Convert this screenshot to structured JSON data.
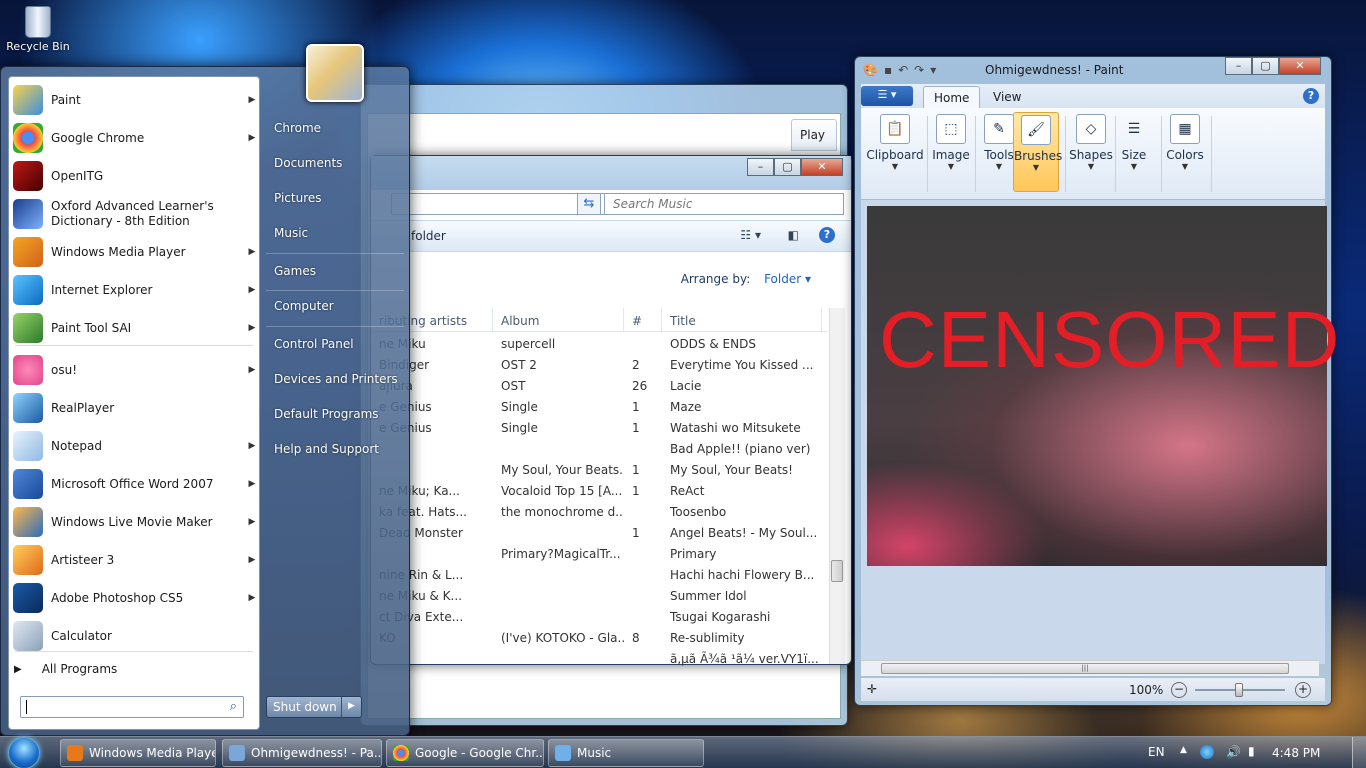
{
  "desktop": {
    "recycle_bin": "Recycle Bin"
  },
  "music_window": {
    "play_tab": "Play",
    "search_placeholder": "Search Music",
    "folder_crumb": "folder",
    "arrange_label": "Arrange by:",
    "arrange_value": "Folder",
    "columns": [
      "ributing artists",
      "Album",
      "#",
      "Title"
    ],
    "rows": [
      [
        "ne Miku",
        "supercell",
        "",
        "ODDS & ENDS"
      ],
      [
        "Bindiger",
        "OST 2",
        "2",
        "Everytime You Kissed ..."
      ],
      [
        "ajiura",
        "OST",
        "26",
        "Lacie"
      ],
      [
        "e Genius",
        "Single",
        "1",
        "Maze"
      ],
      [
        "e Genius",
        "Single",
        "1",
        "Watashi wo Mitsukete"
      ],
      [
        "",
        "",
        "",
        "Bad Apple!! (piano ver)"
      ],
      [
        "",
        "My Soul, Your Beats...",
        "1",
        "My Soul, Your Beats!"
      ],
      [
        "ne Miku; Ka...",
        "Vocaloid Top 15 [A...",
        "1",
        "ReAct"
      ],
      [
        "ka feat. Hats...",
        "the monochrome d...",
        "",
        "Toosenbo"
      ],
      [
        "Dead Monster",
        "",
        "1",
        "Angel Beats! - My Soul..."
      ],
      [
        "",
        "Primary?MagicalTr...",
        "",
        "Primary"
      ],
      [
        "nine Rin & L...",
        "",
        "",
        "Hachi hachi Flowery B..."
      ],
      [
        "ne Miku & K...",
        "",
        "",
        "Summer Idol"
      ],
      [
        "ct Diva Exte...",
        "",
        "",
        "Tsugai Kogarashi"
      ],
      [
        "KO",
        "(I've) KOTOKO - Gla...",
        "8",
        "Re-sublimity"
      ],
      [
        "",
        "",
        "",
        "ã,µã Ã¾ã ¹ã¼ ver.VY1ï..."
      ]
    ]
  },
  "start_menu": {
    "programs": [
      {
        "label": "Paint",
        "icon": "paint-icon",
        "arrow": true
      },
      {
        "label": "Google Chrome",
        "icon": "chrome-icon",
        "arrow": true
      },
      {
        "label": "OpenITG",
        "icon": "openitg-icon",
        "arrow": false
      },
      {
        "label": "Oxford Advanced Learner's Dictionary - 8th Edition",
        "icon": "dictionary-icon",
        "arrow": false
      },
      {
        "label": "Windows Media Player",
        "icon": "media-player-icon",
        "arrow": true
      },
      {
        "label": "Internet Explorer",
        "icon": "internet-explorer-icon",
        "arrow": true
      },
      {
        "label": "Paint Tool SAI",
        "icon": "paint-tool-sai-icon",
        "arrow": true
      },
      {
        "label": "osu!",
        "icon": "osu-icon",
        "arrow": true
      },
      {
        "label": "RealPlayer",
        "icon": "realplayer-icon",
        "arrow": false
      },
      {
        "label": "Notepad",
        "icon": "notepad-icon",
        "arrow": true
      },
      {
        "label": "Microsoft Office Word 2007",
        "icon": "word-icon",
        "arrow": true
      },
      {
        "label": "Windows Live Movie Maker",
        "icon": "movie-maker-icon",
        "arrow": true
      },
      {
        "label": "Artisteer 3",
        "icon": "artisteer-icon",
        "arrow": true
      },
      {
        "label": "Adobe Photoshop CS5",
        "icon": "photoshop-icon",
        "arrow": true
      },
      {
        "label": "Calculator",
        "icon": "calculator-icon",
        "arrow": false
      }
    ],
    "all_programs": "All Programs",
    "right_links": [
      "Chrome",
      "Documents",
      "Pictures",
      "Music",
      "Games",
      "Computer",
      "Control Panel",
      "Devices and Printers",
      "Default Programs",
      "Help and Support"
    ],
    "shutdown": "Shut down"
  },
  "paint": {
    "title": "Ohmigewdness! - Paint",
    "tabs": [
      "Home",
      "View"
    ],
    "groups": [
      "Clipboard",
      "Image",
      "Tools",
      "Brushes",
      "Shapes",
      "Size",
      "Colors"
    ],
    "canvas_text": "CENSORED",
    "zoom": "100%"
  },
  "taskbar": {
    "buttons": [
      "Windows Media Player",
      "Ohmigewdness! - Pa...",
      "Google - Google Chr...",
      "Music"
    ],
    "lang": "EN",
    "time": "4:48 PM"
  },
  "colors": {
    "accent": "#1f62c6",
    "censored": "#e31e26"
  }
}
